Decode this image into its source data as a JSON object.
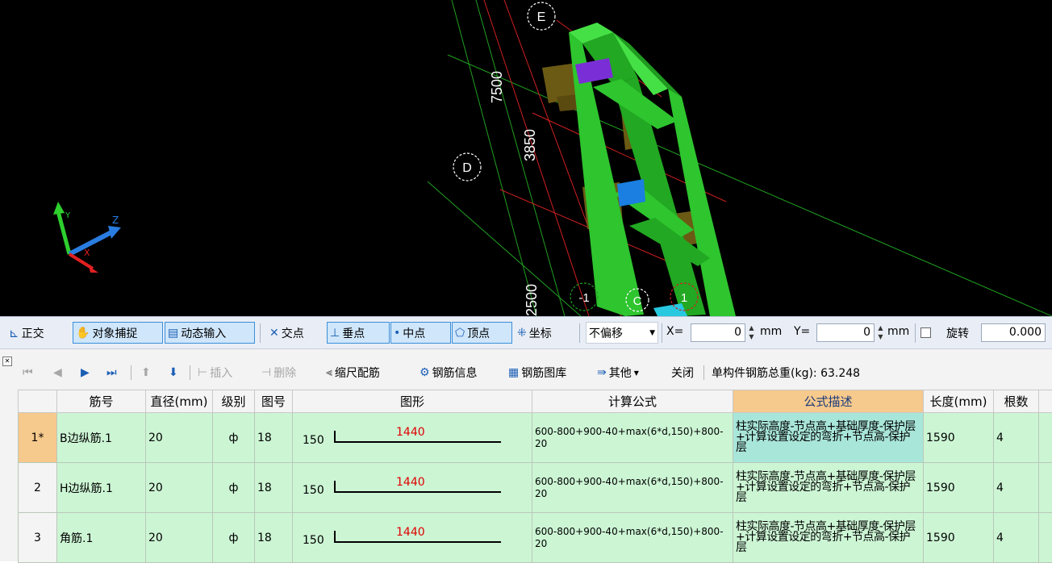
{
  "viewport": {
    "axis_labels": {
      "y": "Y",
      "z": "Z",
      "x": "X"
    },
    "grid_bubbles": [
      "E",
      "D",
      "-1",
      "1",
      "C"
    ],
    "dimensions": [
      "7500",
      "3850",
      "2500"
    ]
  },
  "snapbar": {
    "ortho": "正交",
    "object_snap": "对象捕捉",
    "dynamic_input": "动态输入",
    "intersection": "交点",
    "perpendicular": "垂点",
    "midpoint": "中点",
    "vertex": "顶点",
    "coordinate": "坐标",
    "offset_value": "不偏移",
    "x_label": "X=",
    "x_value": "0",
    "x_unit": "mm",
    "y_label": "Y=",
    "y_value": "0",
    "y_unit": "mm",
    "rotate_label": "旋转",
    "rotate_value": "0.000"
  },
  "gridbar": {
    "insert": "插入",
    "delete": "删除",
    "scale_rebar": "缩尺配筋",
    "rebar_info": "钢筋信息",
    "rebar_library": "钢筋图库",
    "other": "其他",
    "close": "关闭",
    "total_weight": "单构件钢筋总重(kg): 63.248"
  },
  "table": {
    "columns": [
      "筋号",
      "直径(mm)",
      "级别",
      "图号",
      "图形",
      "计算公式",
      "公式描述",
      "长度(mm)",
      "根数"
    ],
    "rows": [
      {
        "num": "1*",
        "name": "B边纵筋.1",
        "dia": "20",
        "grade": "ф",
        "fig": "18",
        "shape_left": "150",
        "shape_val": "1440",
        "formula": "600-800+900-40+max(6*d,150)+800-20",
        "desc": "柱实际高度-节点高+基础厚度-保护层+计算设置设定的弯折+节点高-保护层",
        "length": "1590",
        "count": "4"
      },
      {
        "num": "2",
        "name": "H边纵筋.1",
        "dia": "20",
        "grade": "ф",
        "fig": "18",
        "shape_left": "150",
        "shape_val": "1440",
        "formula": "600-800+900-40+max(6*d,150)+800-20",
        "desc": "柱实际高度-节点高+基础厚度-保护层+计算设置设定的弯折+节点高-保护层",
        "length": "1590",
        "count": "4"
      },
      {
        "num": "3",
        "name": "角筋.1",
        "dia": "20",
        "grade": "ф",
        "fig": "18",
        "shape_left": "150",
        "shape_val": "1440",
        "formula": "600-800+900-40+max(6*d,150)+800-20",
        "desc": "柱实际高度-节点高+基础厚度-保护层+计算设置设定的弯折+节点高-保护层",
        "length": "1590",
        "count": "4"
      }
    ]
  },
  "colors": {
    "column_green": "#2ec52e",
    "footing_olive": "#6b5a14",
    "row_green": "#ccf5d4",
    "header_orange": "#f6c98c"
  }
}
